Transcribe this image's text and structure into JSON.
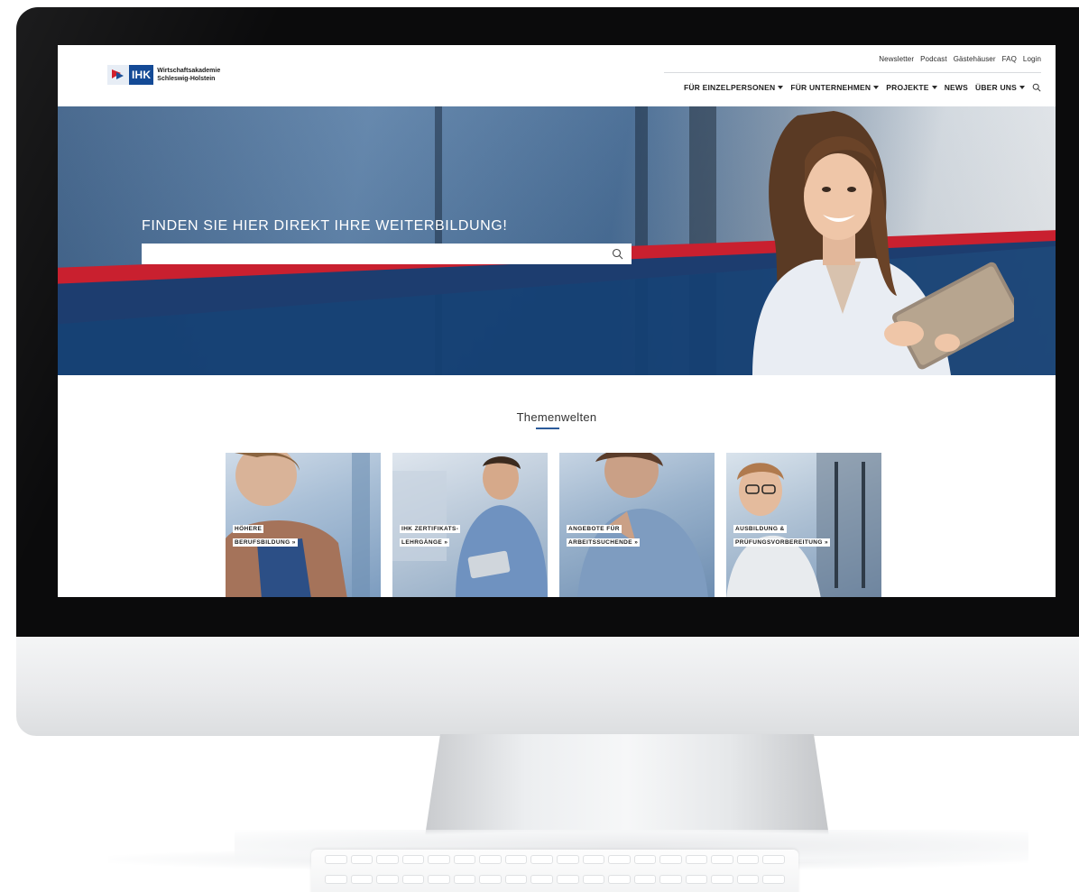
{
  "header": {
    "logo": {
      "mark": "IHK",
      "line1": "Wirtschaftsakademie",
      "line2": "Schleswig-Holstein"
    },
    "util_nav": [
      "Newsletter",
      "Podcast",
      "Gästehäuser",
      "FAQ",
      "Login"
    ],
    "main_nav": [
      {
        "label": "FÜR EINZELPERSONEN",
        "dropdown": true
      },
      {
        "label": "FÜR UNTERNEHMEN",
        "dropdown": true
      },
      {
        "label": "PROJEKTE",
        "dropdown": true
      },
      {
        "label": "NEWS",
        "dropdown": false
      },
      {
        "label": "ÜBER UNS",
        "dropdown": true
      }
    ],
    "search_icon": "search-icon"
  },
  "hero": {
    "headline": "FINDEN SIE HIER DIREKT IHRE WEITERBILDUNG!",
    "search_value": "",
    "search_icon": "search-icon"
  },
  "section": {
    "title": "Themenwelten"
  },
  "cards": [
    {
      "line1": "HÖHERE",
      "line2": "BERUFSBILDUNG »"
    },
    {
      "line1": "IHK ZERTIFIKATS-",
      "line2": "LEHRGÄNGE »"
    },
    {
      "line1": "ANGEBOTE FÜR",
      "line2": "ARBEITSSUCHENDE »"
    },
    {
      "line1": "AUSBILDUNG &",
      "line2": "PRÜFUNGSVORBEREITUNG »"
    }
  ],
  "colors": {
    "brand_blue": "#144a96",
    "brand_red": "#c9202f",
    "accent_blue": "#2b5b9b"
  }
}
